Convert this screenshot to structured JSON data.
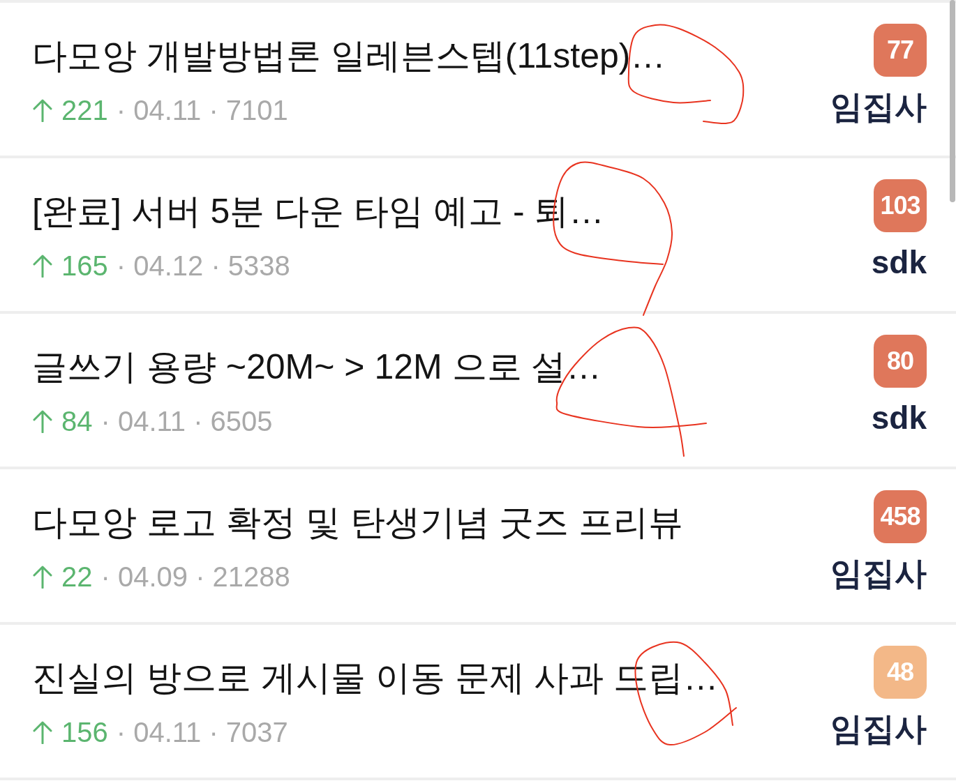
{
  "rows": [
    {
      "title": "다모앙 개발방법론 일레븐스텝(11step)…",
      "votes": "221",
      "meta": "· 04.11 · 7101",
      "comments": "77",
      "color": "#df775b",
      "author": "임집사",
      "marked": true
    },
    {
      "title": "[완료] 서버 5분 다운 타임 예고 - 퇴…",
      "votes": "165",
      "meta": "· 04.12 · 5338",
      "comments": "103",
      "color": "#df775b",
      "author": "sdk",
      "marked": true
    },
    {
      "title": "글쓰기 용량 ~20M~ > 12M 으로 설…",
      "votes": "84",
      "meta": "· 04.11 · 6505",
      "comments": "80",
      "color": "#df775b",
      "author": "sdk",
      "marked": true
    },
    {
      "title": "다모앙 로고 확정 및 탄생기념 굿즈 프리뷰",
      "votes": "22",
      "meta": "· 04.09 · 21288",
      "comments": "458",
      "color": "#df775b",
      "author": "임집사",
      "marked": false
    },
    {
      "title": "진실의 방으로 게시물 이동 문제 사과 드립…",
      "votes": "156",
      "meta": "· 04.11 · 7037",
      "comments": "48",
      "color": "#f3b888",
      "author": "임집사",
      "marked": true
    }
  ]
}
